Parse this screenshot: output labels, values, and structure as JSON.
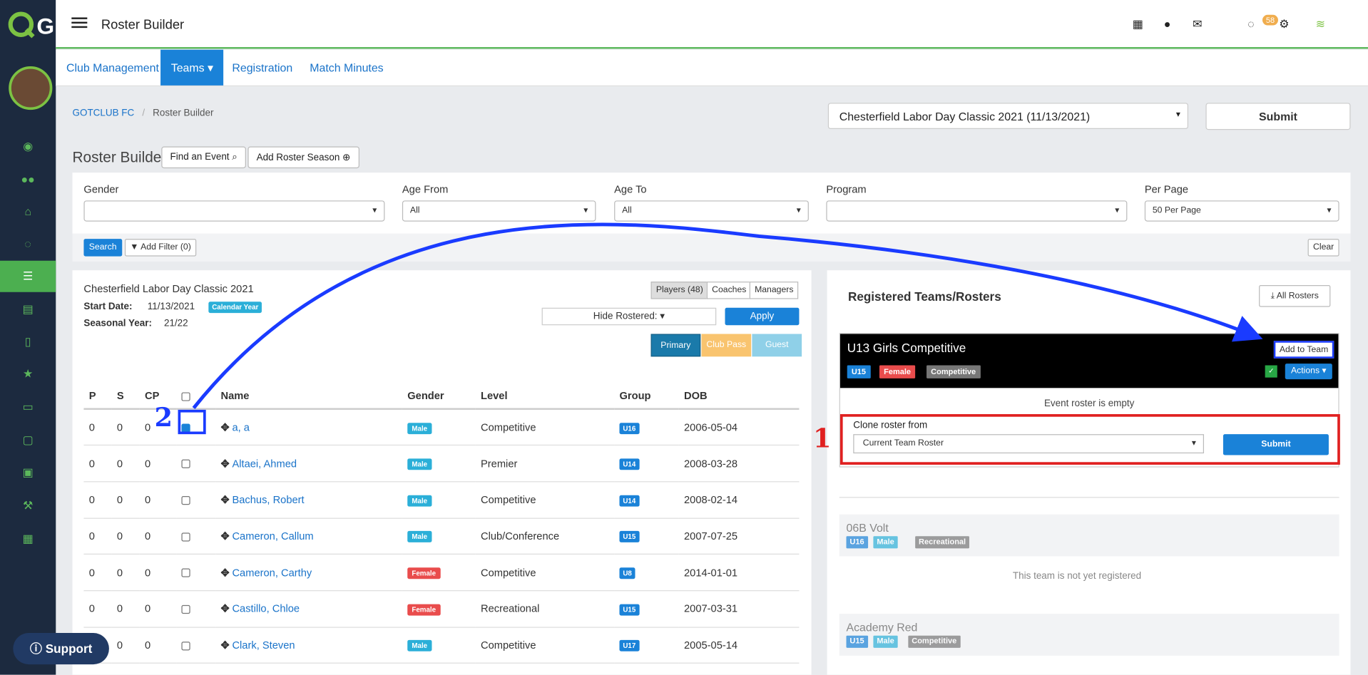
{
  "app": {
    "title": "Roster Builder",
    "mail_badge": "58"
  },
  "nav": {
    "tabs": [
      "Club Management",
      "Teams",
      "Registration",
      "Match Minutes"
    ]
  },
  "breadcrumb": {
    "club": "GOTCLUB FC",
    "current": "Roster Builder"
  },
  "event_select": {
    "value": "Chesterfield Labor Day Classic 2021 (11/13/2021)"
  },
  "buttons": {
    "submit_top": "Submit",
    "find_event": "Find an Event",
    "add_roster_season": "Add Roster Season",
    "search": "Search",
    "add_filter": "Add Filter (0)",
    "clear": "Clear",
    "apply": "Apply",
    "all_rosters": "All Rosters",
    "add_to_team": "Add to Team",
    "actions": "Actions",
    "clone_submit": "Submit",
    "support": "Support"
  },
  "page": {
    "heading": "Roster Builder"
  },
  "filters": {
    "gender_label": "Gender",
    "gender_value": "",
    "age_from_label": "Age From",
    "age_from_value": "All",
    "age_to_label": "Age To",
    "age_to_value": "All",
    "program_label": "Program",
    "program_value": "",
    "per_page_label": "Per Page",
    "per_page_value": "50 Per Page"
  },
  "event": {
    "name": "Chesterfield Labor Day Classic 2021",
    "start_label": "Start Date:",
    "start_value": "11/13/2021",
    "calendar_badge": "Calendar Year",
    "seasonal_label": "Seasonal Year:",
    "seasonal_value": "21/22"
  },
  "groups": {
    "players": "Players (48)",
    "coaches": "Coaches",
    "managers": "Managers",
    "hide_rostered": "Hide Rostered:"
  },
  "passes": {
    "primary": "Primary",
    "club_pass": "Club Pass",
    "guest": "Guest"
  },
  "table": {
    "headers": [
      "P",
      "S",
      "CP",
      "",
      "Name",
      "Gender",
      "Level",
      "Group",
      "DOB"
    ],
    "rows": [
      {
        "p": "0",
        "s": "0",
        "cp": "0",
        "checked": true,
        "name": "a, a",
        "gender": "Male",
        "level": "Competitive",
        "group": "U16",
        "dob": "2006-05-04"
      },
      {
        "p": "0",
        "s": "0",
        "cp": "0",
        "checked": false,
        "name": "Altaei, Ahmed",
        "gender": "Male",
        "level": "Premier",
        "group": "U14",
        "dob": "2008-03-28"
      },
      {
        "p": "0",
        "s": "0",
        "cp": "0",
        "checked": false,
        "name": "Bachus, Robert",
        "gender": "Male",
        "level": "Competitive",
        "group": "U14",
        "dob": "2008-02-14"
      },
      {
        "p": "0",
        "s": "0",
        "cp": "0",
        "checked": false,
        "name": "Cameron, Callum",
        "gender": "Male",
        "level": "Club/Conference",
        "group": "U15",
        "dob": "2007-07-25"
      },
      {
        "p": "0",
        "s": "0",
        "cp": "0",
        "checked": false,
        "name": "Cameron, Carthy",
        "gender": "Female",
        "level": "Competitive",
        "group": "U8",
        "dob": "2014-01-01"
      },
      {
        "p": "0",
        "s": "0",
        "cp": "0",
        "checked": false,
        "name": "Castillo, Chloe",
        "gender": "Female",
        "level": "Recreational",
        "group": "U15",
        "dob": "2007-03-31"
      },
      {
        "p": "",
        "s": "0",
        "cp": "0",
        "checked": false,
        "name": "Clark, Steven",
        "gender": "Male",
        "level": "Competitive",
        "group": "U17",
        "dob": "2005-05-14"
      }
    ]
  },
  "right": {
    "title": "Registered Teams/Rosters",
    "team1": {
      "name": "U13 Girls Competitive",
      "badges": [
        "U15",
        "Female",
        "Competitive"
      ],
      "empty": "Event roster is empty",
      "clone_label": "Clone roster from",
      "clone_value": "Current Team Roster"
    },
    "team2": {
      "name": "06B Volt",
      "badges": [
        "U16",
        "Male",
        "Recreational"
      ],
      "status": "This team is not yet registered"
    },
    "team3": {
      "name": "Academy Red",
      "badges": [
        "U15",
        "Male",
        "Competitive"
      ]
    }
  },
  "annotations": {
    "one": "1",
    "two": "2"
  },
  "colors": {
    "accent": "#1a82d8",
    "brand_green": "#4caf50",
    "sidebar": "#1c2a3f",
    "annotation_red": "#e02020",
    "annotation_blue": "#1a3bff"
  }
}
